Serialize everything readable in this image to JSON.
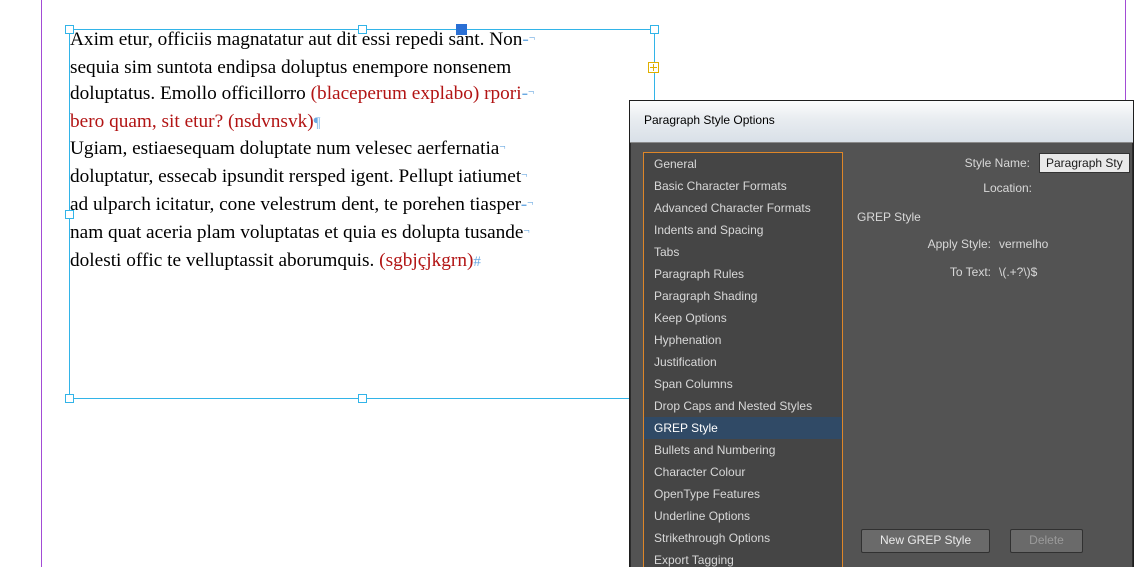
{
  "document": {
    "p1": {
      "a": "Axim etur, officiis magnatatur aut dit essi repedi sant. Non",
      "b": "sequia sim suntota endipsa doluptus enempore nonsenem",
      "c": "doluptatus. Emollo officillorro ",
      "c_red": "(blaceperum explabo) rpori",
      "d_red": "bero quam, sit etur? (nsdvnsvk)"
    },
    "p2": {
      "a": "Ugiam, estiaesequam doluptate num velesec aerfernatia",
      "b": "doluptatur, essecab ipsundit rersped igent. Pellupt iatiumet",
      "c": "ad ulparch icitatur, cone velestrum dent, te porehen tiasper",
      "d": "nam quat aceria plam voluptatas et quia es dolupta tusande",
      "e": "dolesti offic te velluptassit aborumquis. ",
      "e_red": "(sgbjçjkgrn)"
    }
  },
  "dialog": {
    "title": "Paragraph Style Options",
    "styleName": {
      "label": "Style Name:",
      "value": "Paragraph Sty"
    },
    "location": {
      "label": "Location:"
    },
    "categories": [
      "General",
      "Basic Character Formats",
      "Advanced Character Formats",
      "Indents and Spacing",
      "Tabs",
      "Paragraph Rules",
      "Paragraph Shading",
      "Keep Options",
      "Hyphenation",
      "Justification",
      "Span Columns",
      "Drop Caps and Nested Styles",
      "GREP Style",
      "Bullets and Numbering",
      "Character Colour",
      "OpenType Features",
      "Underline Options",
      "Strikethrough Options",
      "Export Tagging"
    ],
    "selectedIndex": 12,
    "panel": {
      "title": "GREP Style",
      "applyStyle": {
        "label": "Apply Style:",
        "value": "vermelho"
      },
      "toText": {
        "label": "To Text:",
        "value": "\\(.+?\\)$"
      }
    },
    "buttons": {
      "new": "New GREP Style",
      "delete": "Delete"
    }
  }
}
